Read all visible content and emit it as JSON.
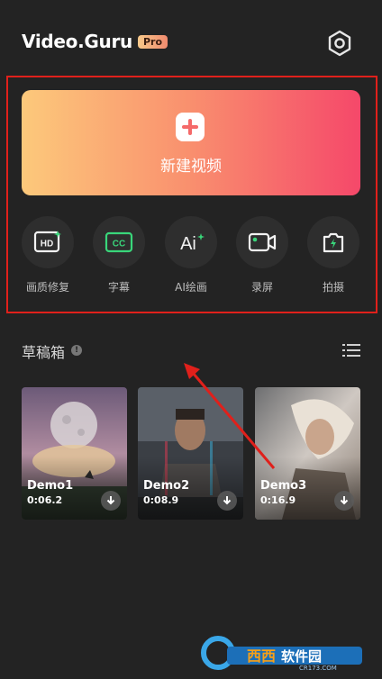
{
  "header": {
    "app_name": "Video.Guru",
    "badge": "Pro",
    "settings_icon": "gear-icon"
  },
  "create": {
    "label": "新建视频",
    "icon": "plus-icon",
    "gradient": [
      "#fcc97b",
      "#f98f6e",
      "#f5486a"
    ]
  },
  "tools": [
    {
      "label": "画质修复",
      "icon": "hd-icon"
    },
    {
      "label": "字幕",
      "icon": "cc-icon"
    },
    {
      "label": "AI绘画",
      "icon": "ai-sparkle-icon"
    },
    {
      "label": "录屏",
      "icon": "screen-record-icon"
    },
    {
      "label": "拍摄",
      "icon": "camera-icon"
    }
  ],
  "drafts": {
    "title": "草稿箱",
    "info_icon": "info-icon",
    "list_icon": "list-view-icon",
    "items": [
      {
        "name": "Demo1",
        "duration": "0:06.2"
      },
      {
        "name": "Demo2",
        "duration": "0:08.9"
      },
      {
        "name": "Demo3",
        "duration": "0:16.9"
      }
    ]
  },
  "watermark": {
    "text": "西西软件园",
    "sub": "CR173.COM"
  },
  "colors": {
    "accent_green": "#39d67a",
    "annotation_red": "#e0201b",
    "background": "#232323"
  }
}
